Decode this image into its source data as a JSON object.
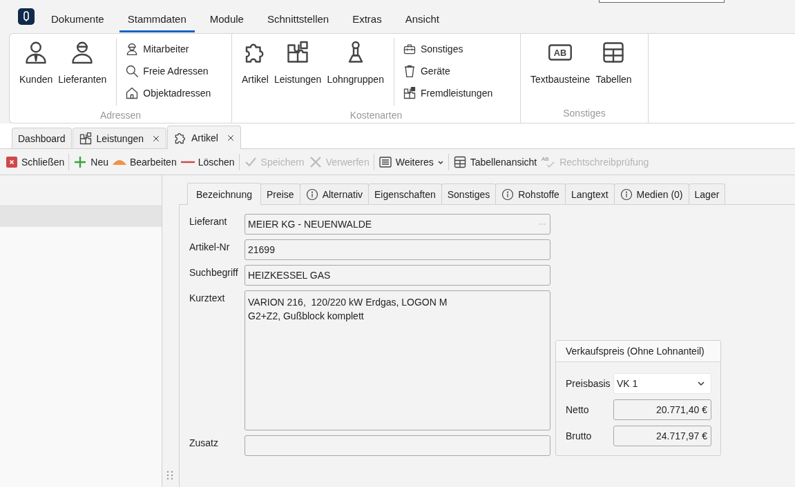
{
  "menu": {
    "tabs": [
      {
        "label": "Dokumente",
        "selected": false
      },
      {
        "label": "Stammdaten",
        "selected": true
      },
      {
        "label": "Module",
        "selected": false
      },
      {
        "label": "Schnittstellen",
        "selected": false
      },
      {
        "label": "Extras",
        "selected": false
      },
      {
        "label": "Ansicht",
        "selected": false
      }
    ]
  },
  "ribbon": {
    "groups": [
      {
        "label": "Adressen",
        "items": [
          {
            "kind": "large",
            "label": "Kunden"
          },
          {
            "kind": "large",
            "label": "Lieferanten"
          },
          {
            "kind": "small",
            "label": "Mitarbeiter"
          },
          {
            "kind": "small",
            "label": "Freie Adressen"
          },
          {
            "kind": "small",
            "label": "Objektadressen"
          }
        ]
      },
      {
        "label": "Kostenarten",
        "items": [
          {
            "kind": "large",
            "label": "Artikel"
          },
          {
            "kind": "large",
            "label": "Leistungen"
          },
          {
            "kind": "large",
            "label": "Lohngruppen"
          },
          {
            "kind": "small",
            "label": "Sonstiges"
          },
          {
            "kind": "small",
            "label": "Geräte"
          },
          {
            "kind": "small",
            "label": "Fremdleistungen"
          }
        ]
      },
      {
        "label": "Sonstiges",
        "items": [
          {
            "kind": "large",
            "label": "Textbausteine",
            "icon_text": "AB"
          },
          {
            "kind": "large",
            "label": "Tabellen"
          }
        ]
      }
    ]
  },
  "document_tabs": [
    {
      "label": "Dashboard",
      "selected": false,
      "closable": false
    },
    {
      "label": "Leistungen",
      "selected": false,
      "closable": true
    },
    {
      "label": "Artikel",
      "selected": true,
      "closable": true
    }
  ],
  "toolbar": {
    "items": [
      {
        "kind": "button",
        "label": "Schließen",
        "disabled": false
      },
      {
        "kind": "separator"
      },
      {
        "kind": "button",
        "label": "Neu",
        "disabled": false
      },
      {
        "kind": "button",
        "label": "Bearbeiten",
        "disabled": false
      },
      {
        "kind": "button",
        "label": "Löschen",
        "disabled": false
      },
      {
        "kind": "separator"
      },
      {
        "kind": "button",
        "label": "Speichern",
        "disabled": true
      },
      {
        "kind": "button",
        "label": "Verwerfen",
        "disabled": true
      },
      {
        "kind": "separator"
      },
      {
        "kind": "dropdown",
        "label": "Weiteres",
        "disabled": false
      },
      {
        "kind": "separator"
      },
      {
        "kind": "button",
        "label": "Tabellenansicht",
        "disabled": false
      },
      {
        "kind": "button",
        "label": "Rechtschreibprüfung",
        "disabled": true,
        "icon_text": "AB"
      }
    ]
  },
  "list": {
    "rows": [
      {
        "selected": true
      }
    ]
  },
  "detail": {
    "tabs": [
      {
        "label": "Bezeichnung",
        "selected": true,
        "info": false
      },
      {
        "label": "Preise",
        "selected": false,
        "info": false
      },
      {
        "label": "Alternativ",
        "selected": false,
        "info": true
      },
      {
        "label": "Eigenschaften",
        "selected": false,
        "info": false
      },
      {
        "label": "Sonstiges",
        "selected": false,
        "info": false
      },
      {
        "label": "Rohstoffe",
        "selected": false,
        "info": true
      },
      {
        "label": "Langtext",
        "selected": false,
        "info": false
      },
      {
        "label": "Medien (0)",
        "selected": false,
        "info": true
      },
      {
        "label": "Lager",
        "selected": false,
        "info": false
      }
    ],
    "fields": [
      {
        "kind": "lookup",
        "label": "Lieferant",
        "value": "MEIER KG - NEUENWALDE"
      },
      {
        "kind": "text",
        "label": "Artikel-Nr",
        "value": "21699"
      },
      {
        "kind": "text",
        "label": "Suchbegriff",
        "value": "HEIZKESSEL GAS"
      },
      {
        "kind": "multiline",
        "label": "Kurztext",
        "value": "VARION 216,  120/220 kW Erdgas, LOGON M\nG2+Z2, Gußblock komplett"
      },
      {
        "kind": "text",
        "label": "Zusatz"
      }
    ],
    "price_box": {
      "title": "Verkaufspreis (Ohne Lohnanteil)",
      "rows": [
        {
          "kind": "select",
          "label": "Preisbasis",
          "value": "VK 1"
        },
        {
          "kind": "amount",
          "label": "Netto",
          "value": "20.771,40 €"
        },
        {
          "kind": "amount",
          "label": "Brutto",
          "value": "24.717,97 €"
        }
      ]
    }
  }
}
